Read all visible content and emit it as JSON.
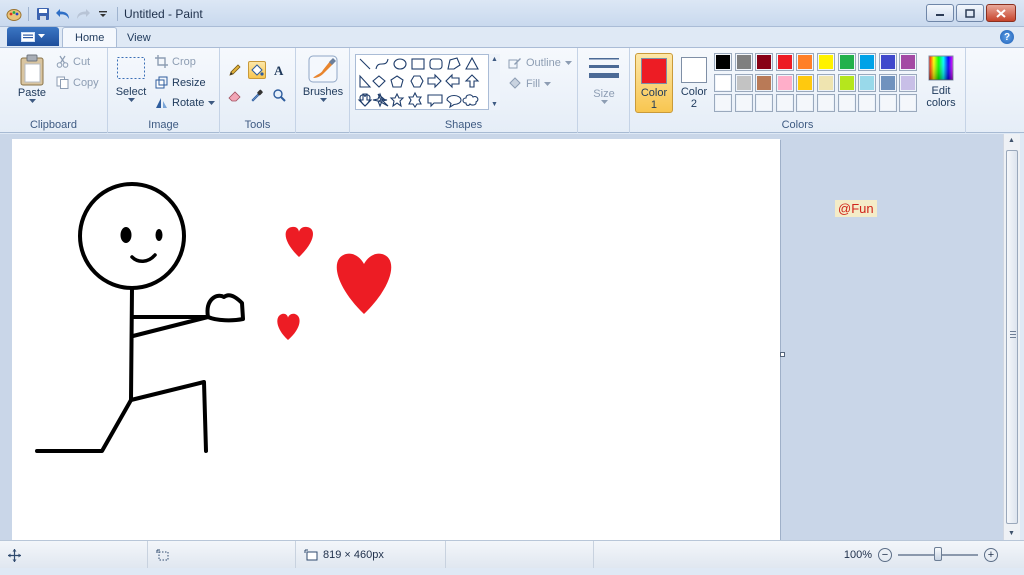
{
  "window": {
    "title": "Untitled - Paint"
  },
  "tabs": {
    "home": "Home",
    "view": "View"
  },
  "clipboard": {
    "paste": "Paste",
    "cut": "Cut",
    "copy": "Copy",
    "group": "Clipboard"
  },
  "image": {
    "select": "Select",
    "crop": "Crop",
    "resize": "Resize",
    "rotate": "Rotate",
    "group": "Image"
  },
  "tools": {
    "group": "Tools",
    "active_tool": "fill-bucket"
  },
  "brushes": {
    "label": "Brushes"
  },
  "shapes": {
    "outline": "Outline",
    "fill": "Fill",
    "group": "Shapes"
  },
  "size": {
    "label": "Size"
  },
  "colors": {
    "color1_label": "Color",
    "color1_num": "1",
    "color2_label": "Color",
    "color2_num": "2",
    "edit_label": "Edit",
    "edit_label2": "colors",
    "group": "Colors",
    "color1": "#ed1c24",
    "color2": "#ffffff",
    "palette_row1": [
      "#000000",
      "#7f7f7f",
      "#880015",
      "#ed1c24",
      "#ff7f27",
      "#fff200",
      "#22b14c",
      "#00a2e8",
      "#3f48cc",
      "#a349a4"
    ],
    "palette_row2": [
      "#ffffff",
      "#c3c3c3",
      "#b97a57",
      "#ffaec9",
      "#ffc90e",
      "#efe4b0",
      "#b5e61d",
      "#99d9ea",
      "#7092be",
      "#c8bfe7"
    ]
  },
  "canvas": {
    "heart_color": "#ed1c24",
    "stroke_color": "#000000"
  },
  "watermark": "@Fun",
  "status": {
    "size": "819 × 460px",
    "zoom": "100%"
  }
}
